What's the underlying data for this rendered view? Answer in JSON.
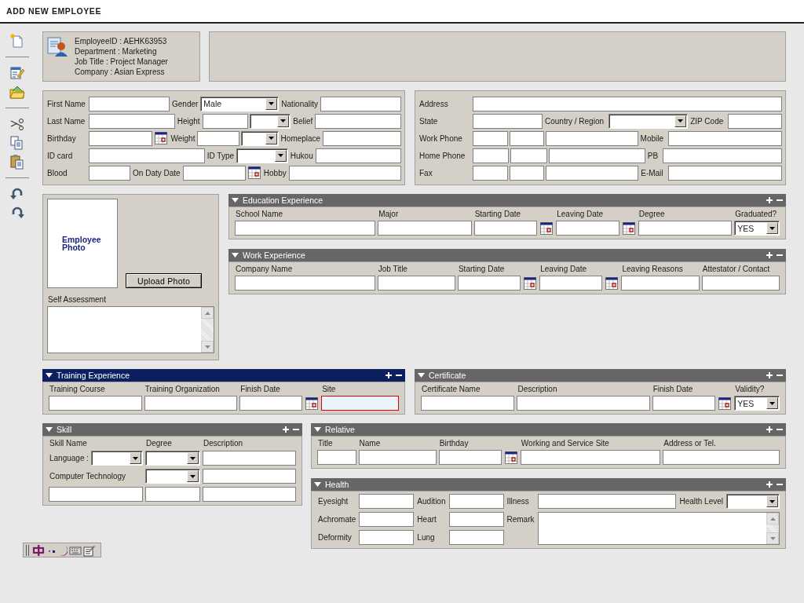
{
  "title": "ADD NEW EMPLOYEE",
  "summary": {
    "lines": [
      "EmployeeID : AEHK63953",
      "Department : Marketing",
      "Job Title : Project Manager",
      "Company : Asian Express"
    ]
  },
  "personal": {
    "rows": [
      [
        {
          "label": "First Name",
          "controls": [
            {
              "kind": "text"
            }
          ]
        },
        {
          "label": "Gender",
          "controls": [
            {
              "kind": "select",
              "value": "Male"
            }
          ]
        },
        {
          "label": "Nationality",
          "controls": [
            {
              "kind": "text"
            }
          ]
        }
      ],
      [
        {
          "label": "Last Name",
          "controls": [
            {
              "kind": "text"
            }
          ]
        },
        {
          "label": "Height",
          "controls": [
            {
              "kind": "text"
            },
            {
              "kind": "select"
            }
          ]
        },
        {
          "label": "Belief",
          "controls": [
            {
              "kind": "text"
            }
          ]
        }
      ],
      [
        {
          "label": "Birthday",
          "controls": [
            {
              "kind": "text"
            },
            {
              "kind": "date"
            }
          ]
        },
        {
          "label": "Weight",
          "controls": [
            {
              "kind": "text"
            },
            {
              "kind": "select"
            }
          ]
        },
        {
          "label": "Homeplace",
          "controls": [
            {
              "kind": "text"
            }
          ]
        }
      ],
      [
        {
          "label": "ID card",
          "controls": [
            {
              "kind": "text"
            }
          ]
        },
        {
          "label": "ID Type",
          "controls": [
            {
              "kind": "select"
            }
          ]
        },
        {
          "label": "Hukou",
          "controls": [
            {
              "kind": "text"
            }
          ]
        }
      ],
      [
        {
          "label": "Blood",
          "controls": [
            {
              "kind": "text"
            }
          ]
        },
        {
          "label": "On Daty Date",
          "controls": [
            {
              "kind": "text"
            },
            {
              "kind": "date"
            }
          ]
        },
        {
          "label": "Hobby",
          "controls": [
            {
              "kind": "text"
            }
          ]
        }
      ]
    ]
  },
  "address": {
    "rows": [
      [
        {
          "label": "Address",
          "controls": [
            {
              "kind": "text"
            }
          ]
        }
      ],
      [
        {
          "label": "State",
          "controls": [
            {
              "kind": "text"
            }
          ]
        },
        {
          "label": "Country / Region",
          "controls": [
            {
              "kind": "select"
            }
          ]
        },
        {
          "label": "ZIP Code",
          "controls": [
            {
              "kind": "text"
            }
          ]
        }
      ],
      [
        {
          "label": "Work Phone",
          "controls": [
            {
              "kind": "text"
            },
            {
              "kind": "text"
            },
            {
              "kind": "text"
            }
          ]
        },
        {
          "label": "Mobile",
          "controls": [
            {
              "kind": "text"
            }
          ]
        }
      ],
      [
        {
          "label": "Home Phone",
          "controls": [
            {
              "kind": "text"
            },
            {
              "kind": "text"
            },
            {
              "kind": "text"
            }
          ]
        },
        {
          "label": "PB",
          "controls": [
            {
              "kind": "text"
            }
          ]
        }
      ],
      [
        {
          "label": "Fax",
          "controls": [
            {
              "kind": "text"
            },
            {
              "kind": "text"
            },
            {
              "kind": "text"
            }
          ]
        },
        {
          "label": "E-Mail",
          "controls": [
            {
              "kind": "text"
            }
          ]
        }
      ]
    ]
  },
  "photo_panel": {
    "caption": "Employee Photo",
    "upload_button": "Upload Photo",
    "self_assessment_label": "Self Assessment"
  },
  "education": {
    "title": "Education Experience",
    "expanded": true,
    "active": false,
    "columns": [
      {
        "label": "School Name",
        "kind": "text"
      },
      {
        "label": "Major",
        "kind": "text"
      },
      {
        "label": "Starting Date",
        "kind": "date"
      },
      {
        "label": "Leaving Date",
        "kind": "date"
      },
      {
        "label": "Degree",
        "kind": "text"
      },
      {
        "label": "Graduated?",
        "kind": "select",
        "value": "YES"
      }
    ]
  },
  "work_experience": {
    "title": "Work Experience",
    "expanded": true,
    "active": false,
    "columns": [
      {
        "label": "Company Name",
        "kind": "text"
      },
      {
        "label": "Job Title",
        "kind": "text"
      },
      {
        "label": "Starting Date",
        "kind": "date"
      },
      {
        "label": "Leaving Date",
        "kind": "date"
      },
      {
        "label": "Leaving Reasons",
        "kind": "text"
      },
      {
        "label": "Attestator / Contact",
        "kind": "text"
      }
    ]
  },
  "training": {
    "title": "Training Experience",
    "expanded": true,
    "active": true,
    "columns": [
      {
        "label": "Training Course",
        "kind": "text",
        "focused": false
      },
      {
        "label": "Training Organization",
        "kind": "text",
        "focused": false
      },
      {
        "label": "Finish Date",
        "kind": "date",
        "focused": false
      },
      {
        "label": "Site",
        "kind": "text",
        "focused": true
      }
    ]
  },
  "certificate": {
    "title": "Certificate",
    "expanded": true,
    "active": false,
    "columns": [
      {
        "label": "Certificate Name",
        "kind": "text"
      },
      {
        "label": "Description",
        "kind": "text"
      },
      {
        "label": "Finish Date",
        "kind": "date"
      },
      {
        "label": "Validity?",
        "kind": "select",
        "value": "YES"
      }
    ]
  },
  "skill": {
    "title": "Skill",
    "expanded": true,
    "active": false,
    "rows": [
      [
        {
          "kind": "label",
          "text": "Skill Name"
        },
        {
          "kind": "label",
          "text": "Degree"
        },
        {
          "kind": "label",
          "text": "Description"
        }
      ],
      [
        {
          "kind": "label_select",
          "text": "Language :"
        },
        {
          "kind": "select"
        },
        {
          "kind": "text"
        }
      ],
      [
        {
          "kind": "label",
          "text": "Computer Technology"
        },
        {
          "kind": "select"
        },
        {
          "kind": "text"
        }
      ],
      [
        {
          "kind": "text"
        },
        {
          "kind": "text"
        },
        {
          "kind": "text"
        }
      ]
    ]
  },
  "relative": {
    "title": "Relative",
    "expanded": true,
    "active": false,
    "columns": [
      {
        "label": "Title",
        "kind": "text"
      },
      {
        "label": "Name",
        "kind": "text"
      },
      {
        "label": "Birthday",
        "kind": "date"
      },
      {
        "label": "Working and Service Site",
        "kind": "text"
      },
      {
        "label": "Address or Tel.",
        "kind": "text"
      }
    ]
  },
  "health": {
    "title": "Health",
    "expanded": true,
    "active": false,
    "fields": [
      [
        {
          "label": "Eyesight",
          "controls": [
            {
              "kind": "text"
            }
          ]
        },
        {
          "label": "Audition",
          "controls": [
            {
              "kind": "text"
            }
          ]
        },
        {
          "label": "Illness",
          "controls": [
            {
              "kind": "text"
            }
          ]
        },
        {
          "label": "Health Level",
          "controls": [
            {
              "kind": "select"
            }
          ]
        }
      ],
      [
        {
          "label": "Achromate",
          "controls": [
            {
              "kind": "text"
            }
          ]
        },
        {
          "label": "Heart",
          "controls": [
            {
              "kind": "text"
            }
          ]
        },
        {
          "label": "Remark",
          "controls": [
            {
              "kind": "textarea"
            }
          ]
        }
      ],
      [
        {
          "label": "Deformity",
          "controls": [
            {
              "kind": "text"
            }
          ]
        },
        {
          "label": "Lung",
          "controls": [
            {
              "kind": "text"
            }
          ]
        }
      ]
    ]
  }
}
